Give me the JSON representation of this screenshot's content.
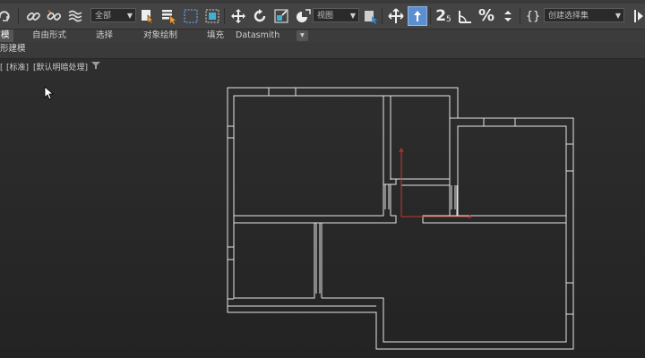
{
  "toolbar": {
    "selection_filter": "全部",
    "reference_coord": "视图",
    "named_selection": "创建选择集",
    "snap_angle_label": "2",
    "snap_angle_sub": "5"
  },
  "ribbon": {
    "tabs": [
      {
        "label": "模"
      },
      {
        "label": "自由形式"
      },
      {
        "label": "选择"
      },
      {
        "label": "对象绘制"
      },
      {
        "label": "填充"
      },
      {
        "label": "Datasmith"
      }
    ],
    "extra_menu": "▾"
  },
  "subbar": {
    "label": "形建模"
  },
  "viewport": {
    "label_left": "[",
    "label_view": "[标准]",
    "label_shading": "[默认明暗处理]",
    "filter_icon": "filter-icon"
  },
  "colors": {
    "toolbar_bg": "#444444",
    "viewport_bg": "#2b2b2b",
    "wall_line": "#e6e6e6",
    "axis_red": "#c0392b",
    "active_button": "#5b8fd0"
  }
}
